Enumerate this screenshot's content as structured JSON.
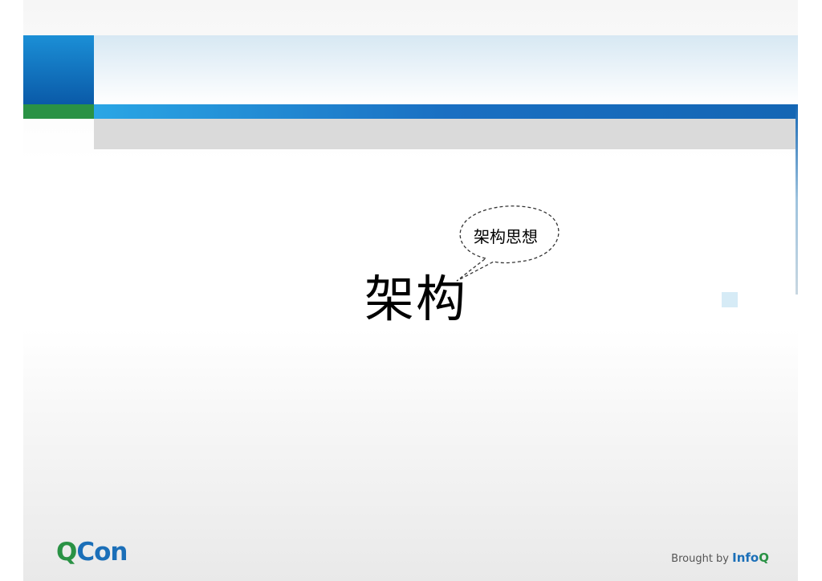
{
  "slide": {
    "title": "架构",
    "bubble_text": "架构思想"
  },
  "footer": {
    "logo_q": "Q",
    "logo_con": "Con",
    "brought_by": "Brought by",
    "brand_info": "Info",
    "brand_q": "Q"
  },
  "colors": {
    "brand_blue": "#1b6fb8",
    "brand_green": "#2a9245"
  }
}
